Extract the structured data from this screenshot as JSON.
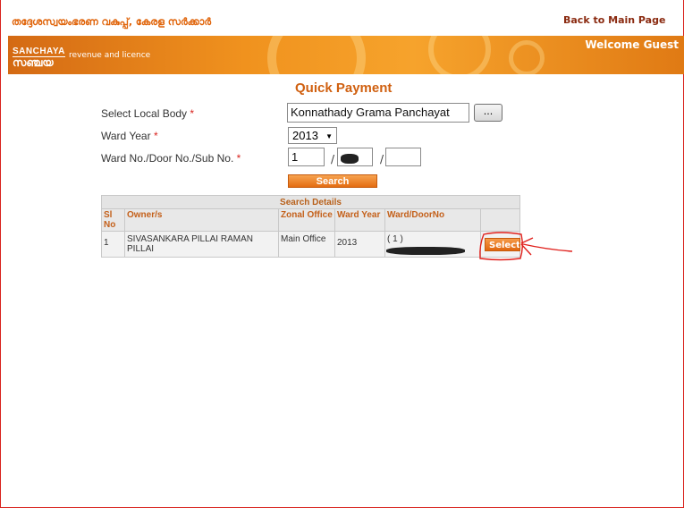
{
  "header": {
    "department": "തദ്ദേശസ്വയംഭരണ വകുപ്പ്, കേരള സർക്കാർ",
    "back_link": "Back to Main Page",
    "logo_en": "SANCHAYA",
    "logo_ml": "സഞ്ചയ",
    "tagline": "revenue and licence",
    "welcome": "Welcome Guest"
  },
  "form": {
    "title": "Quick Payment",
    "local_body_label": "Select Local Body",
    "local_body_value": "Konnathady Grama Panchayat",
    "browse_label": "...",
    "ward_year_label": "Ward Year",
    "ward_year_value": "2013",
    "ward_door_label": "Ward No./Door No./Sub No.",
    "ward_no_value": "1",
    "door_no_value": "",
    "sub_no_value": "",
    "separator": "/",
    "required_mark": "*",
    "search_label": "Search"
  },
  "results": {
    "caption": "Search Details",
    "columns": [
      "Sl No",
      "Owner/s",
      "Zonal Office",
      "Ward Year",
      "Ward/DoorNo",
      ""
    ],
    "rows": [
      {
        "sl_no": "1",
        "owner": "SIVASANKARA PILLAI RAMAN PILLAI",
        "zonal_office": "Main Office",
        "ward_year": "2013",
        "ward_door": "( 1 )",
        "action": "Select"
      }
    ]
  },
  "colors": {
    "accent": "#e46d12",
    "header_text": "#c4601a",
    "annotation": "#e0201c"
  }
}
